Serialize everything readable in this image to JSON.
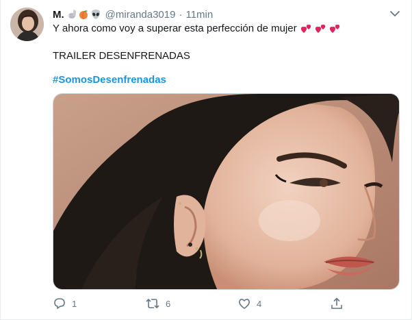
{
  "tweet": {
    "author": {
      "display_name": "M.",
      "emojis": [
        "rabbit-emoji",
        "peach-emoji",
        "alien-emoji"
      ],
      "handle": "@miranda3019",
      "separator": "·",
      "time": "11min"
    },
    "text_line1": "Y ahora como voy a superar esta perfección de mujer",
    "text_emojis": [
      "two-hearts-emoji",
      "two-hearts-emoji",
      "two-hearts-emoji"
    ],
    "text_line2": "TRAILER DESENFRENADAS",
    "hashtag": "#SomosDesenfrenadas",
    "media": {
      "kind": "photo",
      "subject": "woman-face-closeup"
    },
    "actions": {
      "reply": {
        "icon": "reply-icon",
        "count": "1"
      },
      "retweet": {
        "icon": "retweet-icon",
        "count": "6"
      },
      "like": {
        "icon": "heart-icon",
        "count": "4"
      },
      "share": {
        "icon": "share-icon"
      }
    },
    "menu_icon": "chevron-down-icon"
  },
  "colors": {
    "text": "#14171a",
    "secondary": "#657786",
    "link": "#1b95e0",
    "border": "#e6ecf0",
    "heart_emoji": "#e0245e"
  }
}
